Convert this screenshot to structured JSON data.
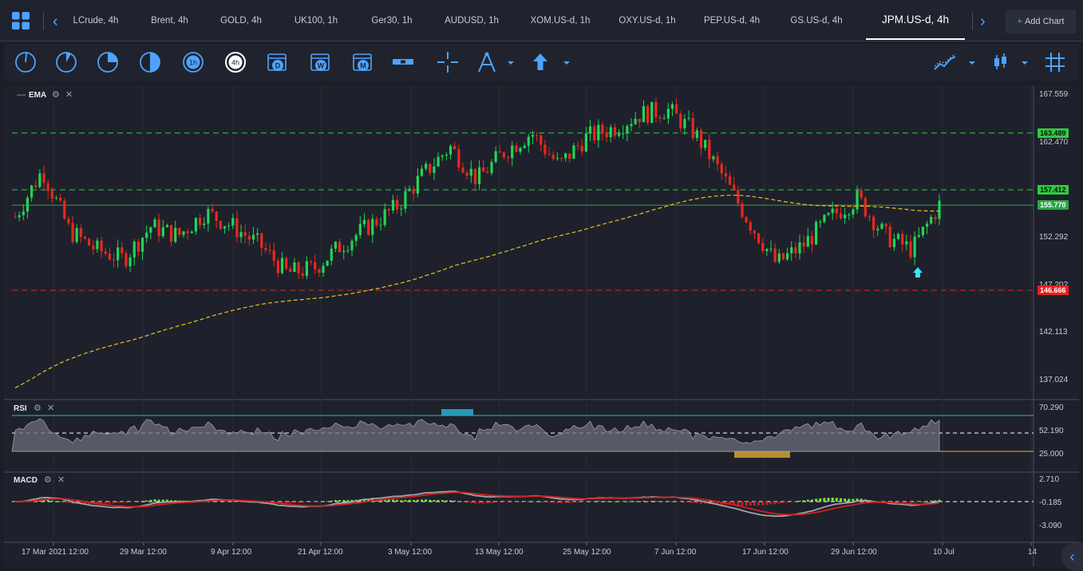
{
  "symbols": {
    "tabs": [
      {
        "label": "LCrude, 4h"
      },
      {
        "label": "Brent, 4h"
      },
      {
        "label": "GOLD, 4h"
      },
      {
        "label": "UK100, 1h"
      },
      {
        "label": "Ger30, 1h"
      },
      {
        "label": "AUDUSD, 1h"
      },
      {
        "label": "XOM.US-d, 1h"
      },
      {
        "label": "OXY.US-d, 1h"
      },
      {
        "label": "PEP.US-d, 4h"
      },
      {
        "label": "GS.US-d, 4h"
      },
      {
        "label": "JPM.US-d, 4h"
      }
    ],
    "active_index": 10,
    "add_chart_label": "Add Chart",
    "add_chart_icon": "plus-icon"
  },
  "toolbar": {
    "timeframes": [
      {
        "icon": "timeframe-1m-icon"
      },
      {
        "icon": "timeframe-5m-icon"
      },
      {
        "icon": "timeframe-15m-icon"
      },
      {
        "icon": "timeframe-30m-icon"
      },
      {
        "icon": "timeframe-1h-icon",
        "label": "1h"
      },
      {
        "icon": "timeframe-4h-icon",
        "label": "4h"
      },
      {
        "icon": "calendar-day-icon",
        "label": "D"
      },
      {
        "icon": "calendar-week-icon",
        "label": "W"
      },
      {
        "icon": "calendar-month-icon",
        "label": "M"
      }
    ],
    "tools": [
      "horizontal-line-icon",
      "crosshair-icon",
      "drawing-tool-icon",
      "arrow-up-icon"
    ],
    "right_tools": [
      "indicators-icon",
      "candle-type-icon",
      "grid-icon"
    ]
  },
  "chart": {
    "main_pane": {
      "indicator_label": "EMA",
      "price_scale": [
        "167.559",
        "162.470",
        "152.292",
        "147.202",
        "142.113",
        "137.024"
      ],
      "tags": [
        {
          "value": "163.489",
          "color": "#2ecc40"
        },
        {
          "value": "157.412",
          "color": "#2ecc40"
        },
        {
          "value": "155.770",
          "color": "#27a844",
          "text_color": "#ffffff"
        },
        {
          "value": "146.666",
          "color": "#e81f1f",
          "text_color": "#ffffff"
        }
      ],
      "lines": {
        "resistance_high": 163.489,
        "resistance": 157.412,
        "current": 155.77,
        "support": 146.666
      }
    },
    "rsi_pane": {
      "label": "RSI",
      "scale": [
        "70.290",
        "52.190",
        "25.000"
      ]
    },
    "macd_pane": {
      "label": "MACD",
      "scale": [
        "2.710",
        "-0.185",
        "-3.090"
      ]
    },
    "dates": [
      "17 Mar 2021 12:00",
      "29 Mar 12:00",
      "9 Apr 12:00",
      "21 Apr 12:00",
      "3 May 12:00",
      "13 May 12:00",
      "25 May 12:00",
      "7 Jun 12:00",
      "17 Jun 12:00",
      "29 Jun 12:00",
      "10 Jul",
      "14"
    ],
    "colors": {
      "up": "#1fd655",
      "down": "#e8281e",
      "ema": "#e8c21e",
      "rsi_upper": "#2ab8d6",
      "rsi_lower": "#e8b23a"
    }
  },
  "chart_data": {
    "type": "candlestick",
    "keypoints_close": [
      [
        "17 Mar 2021",
        154.5
      ],
      [
        "19 Mar",
        159.5
      ],
      [
        "22 Mar",
        153.0
      ],
      [
        "25 Mar",
        151.0
      ],
      [
        "29 Mar",
        150.0
      ],
      [
        "1 Apr",
        153.5
      ],
      [
        "5 Apr",
        152.5
      ],
      [
        "9 Apr",
        155.0
      ],
      [
        "13 Apr",
        153.5
      ],
      [
        "16 Apr",
        151.5
      ],
      [
        "21 Apr",
        148.5
      ],
      [
        "23 Apr",
        149.0
      ],
      [
        "26 Apr",
        151.5
      ],
      [
        "29 Apr",
        153.5
      ],
      [
        "3 May",
        155.5
      ],
      [
        "6 May",
        159.0
      ],
      [
        "10 May",
        162.0
      ],
      [
        "12 May",
        158.5
      ],
      [
        "14 May",
        161.5
      ],
      [
        "18 May",
        163.5
      ],
      [
        "21 May",
        160.0
      ],
      [
        "25 May",
        163.0
      ],
      [
        "28 May",
        164.0
      ],
      [
        "2 Jun",
        165.5
      ],
      [
        "7 Jun",
        166.0
      ],
      [
        "10 Jun",
        163.5
      ],
      [
        "14 Jun",
        159.0
      ],
      [
        "17 Jun",
        154.0
      ],
      [
        "21 Jun",
        149.5
      ],
      [
        "24 Jun",
        151.5
      ],
      [
        "29 Jun",
        154.5
      ],
      [
        "1 Jul",
        156.5
      ],
      [
        "6 Jul",
        152.5
      ],
      [
        "8 Jul",
        151.0
      ],
      [
        "10 Jul",
        155.8
      ]
    ],
    "ylim": [
      137.024,
      167.559
    ]
  }
}
